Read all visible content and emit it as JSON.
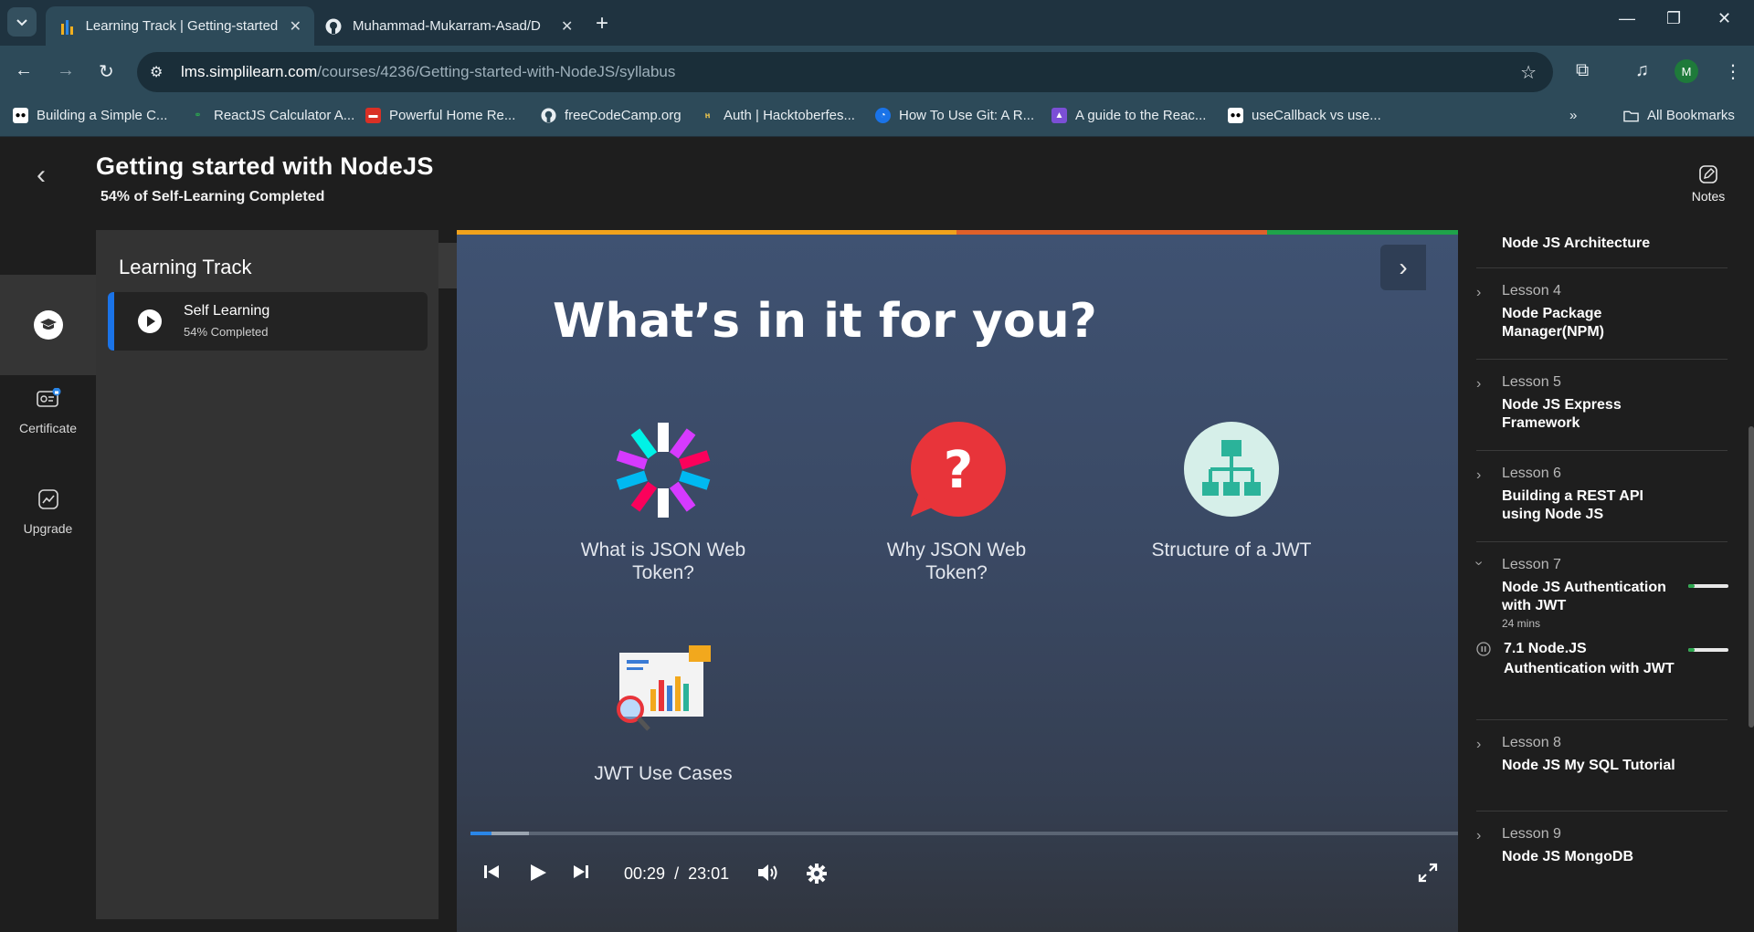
{
  "browser": {
    "tabs": [
      {
        "title": "Learning Track | Getting-started",
        "active": true,
        "icon": "simplilearn-icon"
      },
      {
        "title": "Muhammad-Mukarram-Asad/D",
        "active": false,
        "icon": "github-icon"
      }
    ],
    "url_host": "lms.simplilearn.com",
    "url_path": "/courses/4236/Getting-started-with-NodeJS/syllabus",
    "profile_initial": "M",
    "bookmarks": [
      "Building a Simple C...",
      "ReactJS Calculator A...",
      "Powerful Home Re...",
      "freeCodeCamp.org",
      "Auth | Hacktoberfes...",
      "How To Use Git: A R...",
      "A guide to the Reac...",
      "useCallback vs use..."
    ],
    "all_bookmarks": "All Bookmarks"
  },
  "header": {
    "title": "Getting started with NodeJS",
    "progress": "54% of Self-Learning Completed",
    "notes_label": "Notes"
  },
  "rail": {
    "certificate": "Certificate",
    "upgrade": "Upgrade"
  },
  "track": {
    "heading": "Learning Track",
    "card_name": "Self Learning",
    "card_sub": "54% Completed"
  },
  "slide": {
    "title": "What’s in it for you?",
    "items": [
      "What is JSON Web Token?",
      "Why JSON Web Token?",
      "Structure of a JWT",
      "JWT Use Cases"
    ]
  },
  "player": {
    "current_time": "00:29",
    "separator": "/",
    "duration": "23:01",
    "played_fraction": 0.021
  },
  "syllabus": {
    "partial_top": "Node JS Architecture",
    "lessons": [
      {
        "num": "Lesson 4",
        "name": "Node Package Manager(NPM)"
      },
      {
        "num": "Lesson 5",
        "name": "Node JS Express Framework"
      },
      {
        "num": "Lesson 6",
        "name": "Building a REST API using Node JS"
      },
      {
        "num": "Lesson 7",
        "name": "Node JS Authentication with JWT",
        "duration": "24 mins",
        "progress": 0.15
      },
      {
        "num": "Lesson 8",
        "name": "Node JS My SQL Tutorial"
      },
      {
        "num": "Lesson 9",
        "name": "Node JS MongoDB"
      }
    ],
    "sub_item": {
      "name": "7.1 Node.JS Authentication with JWT",
      "progress": 0.15
    }
  },
  "colors": {
    "accent_blue": "#1a73e8",
    "progress_green": "#2da84f",
    "video_top_bar": [
      "#f0a21c",
      "#e0602a",
      "#1fa34a"
    ]
  }
}
